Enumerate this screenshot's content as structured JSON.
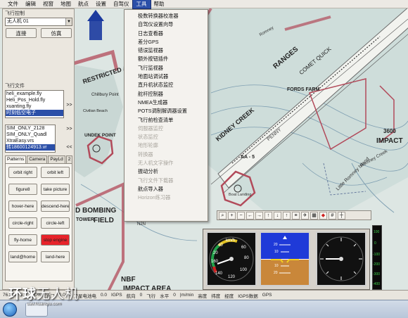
{
  "menubar": {
    "items": [
      {
        "label": "文件",
        "active": false
      },
      {
        "label": "编辑",
        "active": false
      },
      {
        "label": "视窗",
        "active": false
      },
      {
        "label": "地图",
        "active": false
      },
      {
        "label": "航点",
        "active": false
      },
      {
        "label": "设置",
        "active": false
      },
      {
        "label": "自驾仪",
        "active": false
      },
      {
        "label": "工具",
        "active": true
      },
      {
        "label": "帮助",
        "active": false
      }
    ]
  },
  "left_panel": {
    "flight_control_title": "飞行控制",
    "vehicle_selected": "无人机 01",
    "connect_label": "连接",
    "sim_label": "仿真",
    "flight_files_title": "飞行文件",
    "file_list": [
      "heli_example.fly",
      "Heli_Pos_Hold.fly",
      "xuanting.fly",
      "时刻低空电子"
    ],
    "file_list_selected": 3,
    "sim_list": [
      "SIM_ONLY_2128",
      "SIM_ONLY_Quadl",
      "XtraEasy.vrs",
      "转18600124913.vr"
    ],
    "sim_list_selected": 3,
    "forward_label": ">>",
    "back_label": "<<",
    "tabs": [
      "Patterns",
      "Camera",
      "PayLd",
      "2"
    ],
    "active_tab": 0,
    "pattern_buttons": [
      {
        "label": "orbit right",
        "red": false
      },
      {
        "label": "orbit left",
        "red": false
      },
      {
        "label": "figure8",
        "red": false
      },
      {
        "label": "take picture",
        "red": false
      },
      {
        "label": "hover-here",
        "red": false
      },
      {
        "label": "descend-here",
        "red": false
      },
      {
        "label": "circle-right",
        "red": false
      },
      {
        "label": "circle-left",
        "red": false
      },
      {
        "label": "fly-home",
        "red": false
      },
      {
        "label": "stop engine",
        "red": true
      },
      {
        "label": "land@home",
        "red": false
      },
      {
        "label": "land-here",
        "red": false
      }
    ]
  },
  "tools_menu": {
    "items": [
      {
        "label": "极数转换器校准器",
        "disabled": false
      },
      {
        "label": "自驾仪设置向导",
        "disabled": false
      },
      {
        "label": "日志查看器",
        "disabled": false
      },
      {
        "label": "差分GPS",
        "disabled": false
      },
      {
        "label": "错误监视器",
        "disabled": false
      },
      {
        "label": "额外按钮插件",
        "disabled": false
      },
      {
        "label": "飞行监视器",
        "disabled": false
      },
      {
        "label": "地面站调试器",
        "disabled": false
      },
      {
        "label": "直升机状态监控",
        "disabled": false
      },
      {
        "label": "舵杆控制器",
        "disabled": false
      },
      {
        "label": "NMEA生成器",
        "disabled": false
      },
      {
        "label": "POTS调制解调器设置",
        "disabled": false
      },
      {
        "label": "飞行前检查清单",
        "disabled": false
      },
      {
        "label": "伺服器监控",
        "disabled": true
      },
      {
        "label": "状态监控",
        "disabled": true
      },
      {
        "label": "地形轮廓",
        "disabled": true
      },
      {
        "label": "转换器",
        "disabled": true
      },
      {
        "label": "无人机文字操作",
        "disabled": true
      },
      {
        "label": "振动分析",
        "disabled": false
      },
      {
        "label": "飞行文件下载器",
        "disabled": true
      },
      {
        "label": "航点导入器",
        "disabled": false
      },
      {
        "label": "Horizon练习器",
        "disabled": true
      }
    ]
  },
  "map": {
    "labels": {
      "restricted": "RESTRICTED AR",
      "chillbury": "Chillbury Point",
      "civilian_beach": "Civilian Beach",
      "undek": "UNDEK POINT",
      "bombing": "D BOMBING",
      "field": "FIELD",
      "tower": "TOWER",
      "nbf": "NBF",
      "impact_area": "IMPACT AREA",
      "fords_farm": "FORDS FARM",
      "kidney_creek": "KIDNEY CREEK",
      "ranges": "RANGES",
      "comet_quick": "COMET QUICK",
      "penny": "PENNY",
      "impact_right": "IMPACT",
      "elev_3600": "3600",
      "aa5": "AA - 5",
      "romney": "Romney",
      "little_romney": "Little Romney Island",
      "romney_creek": "Romney Creek",
      "boat_landing": "Boat Landing",
      "n2n": "N2N"
    }
  },
  "instruments": {
    "airspeed_unit": "km/h",
    "airspeed_ticks": [
      "60",
      "80",
      "100",
      "120",
      "140",
      "160",
      "40",
      "20"
    ],
    "pitch_ticks": [
      "20",
      "10",
      "10",
      "20"
    ],
    "vertical_speed_ticks": [
      "0",
      "-400",
      "-300",
      "-200",
      "-100",
      "100"
    ]
  },
  "statusbar": {
    "items": [
      "76.2 V",
      "8.1",
      "0.0%",
      "油门",
      "0.0%",
      "卫星电池电",
      "0.0",
      "IGPS",
      "航向",
      "0",
      "飞行",
      "水平",
      "0",
      "|m/min",
      "高度",
      "纬度",
      "经度",
      "IGPS数据",
      "GPS"
    ]
  },
  "watermark": {
    "chinese_bold": "环球",
    "chinese_light": "无人机",
    "url": "uav.huanqiu.com"
  },
  "colors": {
    "menu_highlight": "#2b4fa8",
    "stop_engine": "#e8232a",
    "restricted_area": "#b24a5a",
    "selection": "#2b4fa8"
  }
}
